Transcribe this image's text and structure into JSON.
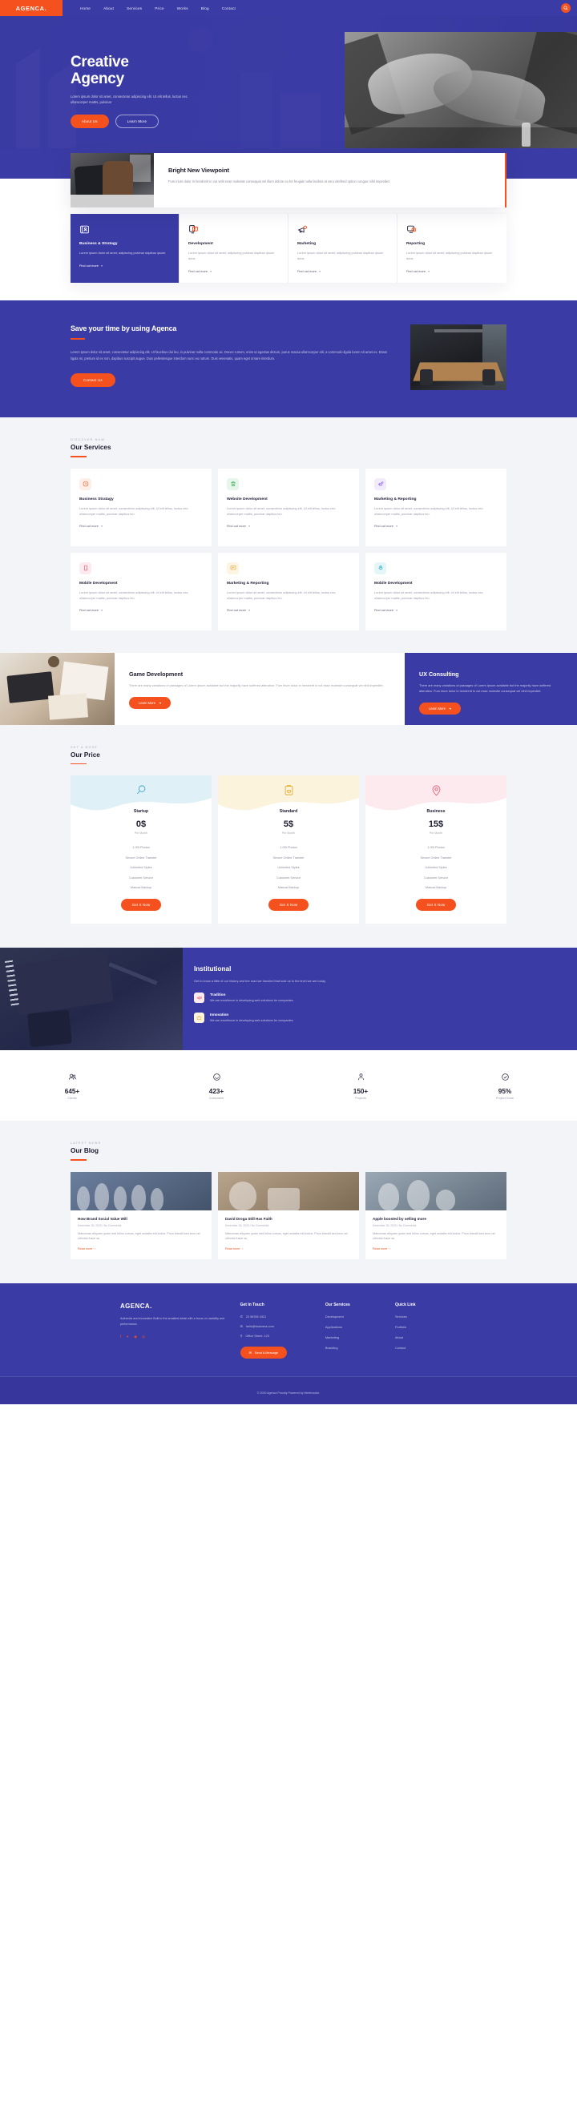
{
  "nav": {
    "logo": "AGENCA.",
    "links": [
      "Home",
      "About",
      "Services",
      "Price",
      "Works",
      "Blog",
      "Contact"
    ],
    "search_icon": "search-icon"
  },
  "hero": {
    "title_line1": "Creative",
    "title_line2": "Agency",
    "subtitle": "Lorem ipsum dolor sit amet, consectetur adipiscing elit. Ut elit tellus, luctus nec ullamcorper mattis, pulvinar",
    "btn_primary": "About Us",
    "btn_secondary": "Learn More"
  },
  "viewpoint": {
    "title": "Bright New Viewpoint",
    "text": "Fum iriure dolor in hendrerit in vut velit esse molestie consequat vel illum dolore eu fer feugiat nulla facilisis at vero eleifend option congue nihil imperdiet."
  },
  "features": [
    {
      "icon": "contact-card-icon",
      "title": "Business & Stratagy",
      "text": "Lorem ipsum dolor sit amet, adipiscing pulvinar dapibus ipsum.",
      "link": "Find out more",
      "active": true
    },
    {
      "icon": "monitor-code-icon",
      "title": "Development",
      "text": "Lorem ipsum dolor sit amet, adipiscing pulvinar dapibus ipsum dolor.",
      "link": "Find out more",
      "active": false
    },
    {
      "icon": "megaphone-icon",
      "title": "Marketing",
      "text": "Lorem ipsum dolor sit amet, adipiscing pulvinar dapibus ipsum dolor.",
      "link": "Find out more",
      "active": false
    },
    {
      "icon": "chart-report-icon",
      "title": "Reporting",
      "text": "Lorem ipsum dolor sit amet, adipiscing pulvinar dapibus ipsum dolor.",
      "link": "Find out more",
      "active": false
    }
  ],
  "savetime": {
    "title": "Save your time by using Agenca",
    "text": "Lorem ipsum dolor sit amet, consectetur adipiscing elit. Ut faucibus dui leo, in pulvinar nulla commodo ac. Donec rutrum, enim ut egestas dictum, purus massa ullamcorper elit, a commodo ligula lorem sit amet ex. Etiam ligula mi, pretium id ex non, dapibus suscipit augue. Duis pellentesque interdum nunc eu rutrum. Duis venenatis, quam eget ornare interdum.",
    "button": "Contact Us"
  },
  "services": {
    "kicker": "Discover Now",
    "title": "Our Services",
    "cards": [
      {
        "icon": "clock-icon",
        "icon_bg": "#fdeee8",
        "icon_color": "#f4511e",
        "title": "Business Stratagy",
        "text": "Lorem ipsum dolor sit amet, consectetur adipiscing elit. Ut elit tellus, luctus nec ullamcorper mattis, pulvinar dapibus leo.",
        "link": "Find out more"
      },
      {
        "icon": "trash-icon",
        "icon_bg": "#e6f6ea",
        "icon_color": "#3aab5d",
        "title": "Website Development",
        "text": "Lorem ipsum dolor sit amet, consectetur adipiscing elit. Ut elit tellus, luctus nec ullamcorper mattis, pulvinar dapibus leo.",
        "link": "Find out more"
      },
      {
        "icon": "megaphone-icon",
        "icon_bg": "#f1ebfb",
        "icon_color": "#8a5cf0",
        "title": "Marketing & Reporting",
        "text": "Lorem ipsum dolor sit amet, consectetur adipiscing elit. Ut elit tellus, luctus nec ullamcorper mattis, pulvinar dapibus leo.",
        "link": "Find out more"
      },
      {
        "icon": "mobile-icon",
        "icon_bg": "#fdeaee",
        "icon_color": "#e8456b",
        "title": "Mobile Development",
        "text": "Lorem ipsum dolor sit amet, consectetur adipiscing elit. Ut elit tellus, luctus nec ullamcorper mattis, pulvinar dapibus leo.",
        "link": "Find out more"
      },
      {
        "icon": "chart-report-icon",
        "icon_bg": "#fdf4e3",
        "icon_color": "#e2a22a",
        "title": "Marketing & Reporting",
        "text": "Lorem ipsum dolor sit amet, consectetur adipiscing elit. Ut elit tellus, luctus nec ullamcorper mattis, pulvinar dapibus leo.",
        "link": "Find out more"
      },
      {
        "icon": "rocket-icon",
        "icon_bg": "#e4f6f8",
        "icon_color": "#28a9bd",
        "title": "Mobile Development",
        "text": "Lorem ipsum dolor sit amet, consectetur adipiscing elit. Ut elit tellus, luctus nec ullamcorper mattis, pulvinar dapibus leo.",
        "link": "Find out more"
      }
    ]
  },
  "gameux": {
    "game": {
      "title": "Game Development",
      "text": "There are many variations of passages of Lorem Ipsum available but the majority have suffered alteration. Fum iriure dolor in hendrerit in vut esse molestie consequat vel nihil imperdiet.",
      "button": "Learn More"
    },
    "ux": {
      "title": "UX Consulting",
      "text": "There are many variations of passages of Lorem Ipsum available but the majority have suffered alteration. Fum iriure dolor in hendrerit in vut esse molestie consequat vel nihil imperdiet.",
      "button": "Learn More"
    }
  },
  "pricing": {
    "kicker": "Get A Move",
    "title": "Our Price",
    "plans": [
      {
        "icon": "magnifier-icon",
        "icon_color": "#4aa6c9",
        "blob": "#dff0f7",
        "name": "Startup",
        "amount": "0$",
        "period": "Per Month",
        "features": [
          "1 GB Photos",
          "Secure Online Transfer",
          "Unlimited Styles",
          "Customer Service",
          "Manual Backup"
        ],
        "button": "Get It Now"
      },
      {
        "icon": "clipboard-heart-icon",
        "icon_color": "#e2b23a",
        "blob": "#fcf3dd",
        "name": "Standard",
        "amount": "5$",
        "period": "Per Month",
        "features": [
          "1 GB Photos",
          "Secure Online Transfer",
          "Unlimited Styles",
          "Customer Service",
          "Manual Backup"
        ],
        "button": "Get It Now"
      },
      {
        "icon": "location-pin-icon",
        "icon_color": "#e8627c",
        "blob": "#fdeaee",
        "name": "Business",
        "amount": "15$",
        "period": "Per Month",
        "features": [
          "1 GB Photos",
          "Secure Online Transfer",
          "Unlimited Styles",
          "Customer Service",
          "Manual Backup"
        ],
        "button": "Get It Now"
      }
    ]
  },
  "institutional": {
    "title": "Institutional",
    "text": "Get to know a little of our history and the road we traveled that took us to the level we are today.",
    "items": [
      {
        "icon": "megaphone-icon",
        "icon_bg": "#fdeaee",
        "icon_color": "#e8456b",
        "title": "Tradition",
        "text": "We are excellence in developing web solutions for companies."
      },
      {
        "icon": "basket-icon",
        "icon_bg": "#fcf3dd",
        "icon_color": "#e2b23a",
        "title": "Innovation",
        "text": "We are excellence in developing web solutions for companies."
      }
    ]
  },
  "stats": [
    {
      "icon": "clients-icon",
      "number": "645+",
      "label": "Clients"
    },
    {
      "icon": "customers-icon",
      "number": "423+",
      "label": "Customers"
    },
    {
      "icon": "projects-icon",
      "number": "150+",
      "label": "Projects"
    },
    {
      "icon": "done-icon",
      "number": "95%",
      "label": "Project Done"
    }
  ],
  "blog": {
    "kicker": "Latest News",
    "title": "Our Blog",
    "posts": [
      {
        "title": "How Brand Social Value Will",
        "meta": "December 26, 2020 / No Comments",
        "text": "Maecenas aliquam quam sed tellus cursus, eget sodales est luctus. Proin blandit sed arcu vel ultricies fusce ac.",
        "link": "Read more"
      },
      {
        "title": "David Droga Still Has Faith",
        "meta": "December 26, 2020 / No Comments",
        "text": "Maecenas aliquam quam sed tellus cursus, eget sodales est luctus. Proin blandit sed arcu vel ultricies fusce ac.",
        "link": "Read more"
      },
      {
        "title": "Apple boosted by selling more",
        "meta": "December 26, 2020 / No Comments",
        "text": "Maecenas aliquam quam sed tellus cursus, eget sodales est luctus. Proin blandit sed arcu vel ultricies fusce ac.",
        "link": "Read more"
      }
    ]
  },
  "footer": {
    "logo": "AGENCA.",
    "description": "Authentic and innovative Built to the smallest detail with a focus on usability and performance.",
    "socials": [
      "facebook-icon",
      "twitter-icon",
      "dribbble-icon",
      "instagram-icon"
    ],
    "contact": {
      "heading": "Get In Touch",
      "phone": "23 98765 4321",
      "email": "hello@business.com",
      "address": "Office Street, 123",
      "button": "Send A Message"
    },
    "services": {
      "heading": "Our Services",
      "links": [
        "Development",
        "Applications",
        "Marketing",
        "Branding"
      ]
    },
    "quick": {
      "heading": "Quick Link",
      "links": [
        "Services",
        "Portfolio",
        "About",
        "Contact"
      ]
    },
    "copyright": "© 2020 Agenca Proudly Powered by Meetmcode."
  }
}
